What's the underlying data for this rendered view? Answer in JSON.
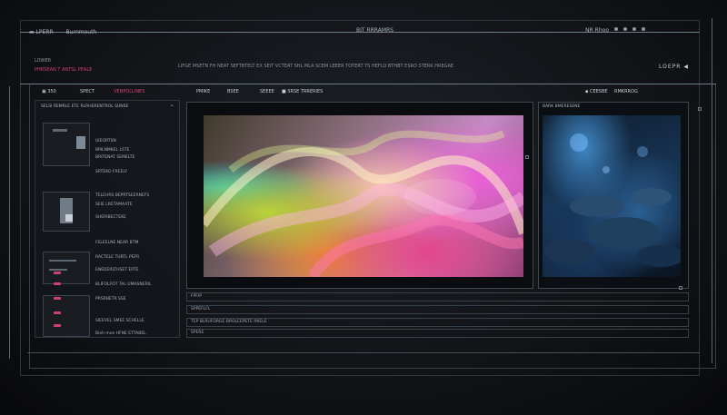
{
  "titlebar": {
    "left_a": "▬ LPERR",
    "left_b": "Burnmouth",
    "center": "BIT RRRAMRS",
    "right": "NR Rhoo"
  },
  "urlrow": {
    "line1": "LOWER",
    "line2": "PHRSEAN T ANTSL PEALE",
    "address": "LIFGE MSETN FH NEAT SEFTBTELT EX SEIT VCTEAT SHL MLA SCEM LEEER TOTERT TS HEFLO BTHBT ESRO STERK HREGAE",
    "brand": "LOEPR ◀"
  },
  "toolbar": {
    "item1": "▣ 350",
    "item2": "SPECT",
    "item3": "VENPOLLINES",
    "item4": "PMIKE",
    "item5": "BSEE",
    "item6": "SEEEE",
    "item7": "■ SRSE TRRERIES"
  },
  "sidebar": {
    "header": "SELSI REMRLE ETE RLRHERENTROL SUNSE",
    "items": [
      "UIEORTSN",
      "BMLNMKEL LSTE",
      "BRITENAT SEMELTE",
      "SRTEKO FREELY",
      "TELEHRS BEPRTSEERNEFS",
      "SEIE LRETAMAATE",
      "SHERIBECTEKE",
      "FELEELNE NEAR BTM",
      "RACTELE TURTL PEFR",
      "ENEDERLTHSET ERTE",
      "BLIFOLFOT TAL UMASNERIL",
      "PRSRBETR SSE",
      "SIEEVEL SMEE SCHELLE",
      "Bieh mve HFNE ETTABEL"
    ]
  },
  "side_viewer": {
    "header": "BARK BMERESENE"
  },
  "tabs_right": {
    "a": "▪ CEESBE",
    "b": "RMKRROG"
  },
  "status": {
    "row1": "FPFIP",
    "row2": "SPPEFLFL",
    "row3": "TEP BLRUFORGE BROLEEPETE RKELE",
    "row4": "SPERE"
  },
  "colors": {
    "accent": "#d0436f",
    "frame": "#3d4853",
    "background": "#121418"
  }
}
